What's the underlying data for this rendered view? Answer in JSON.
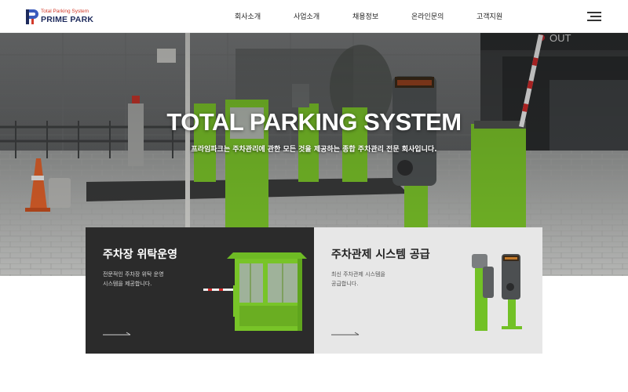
{
  "header": {
    "logo_tagline": "Total Parking System",
    "logo_name": "PRIME PARK",
    "nav": [
      "회사소개",
      "사업소개",
      "채용정보",
      "온라인문의",
      "고객지원"
    ],
    "menu_icon": "hamburger-menu-icon"
  },
  "hero": {
    "title": "TOTAL PARKING SYSTEM",
    "subtitle": "프라임파크는 주차관리에 관한 모든 것을 제공하는 종합 주차관리 전문 회사입니다.",
    "sign_text": "OUT"
  },
  "cards": [
    {
      "title": "주차장 위탁운영",
      "desc_line1": "전문적인 주차장 위탁 운영",
      "desc_line2": "시스템을 제공합니다."
    },
    {
      "title": "주차관제 시스템 공급",
      "desc_line1": "최신 주차관제 시스템을",
      "desc_line2": "공급합니다."
    }
  ],
  "colors": {
    "brand_navy": "#1d2a5c",
    "brand_red": "#d23a2a",
    "equipment_green": "#7cc62a",
    "card_dark": "#2b2b2b",
    "card_light": "#e7e7e7"
  }
}
